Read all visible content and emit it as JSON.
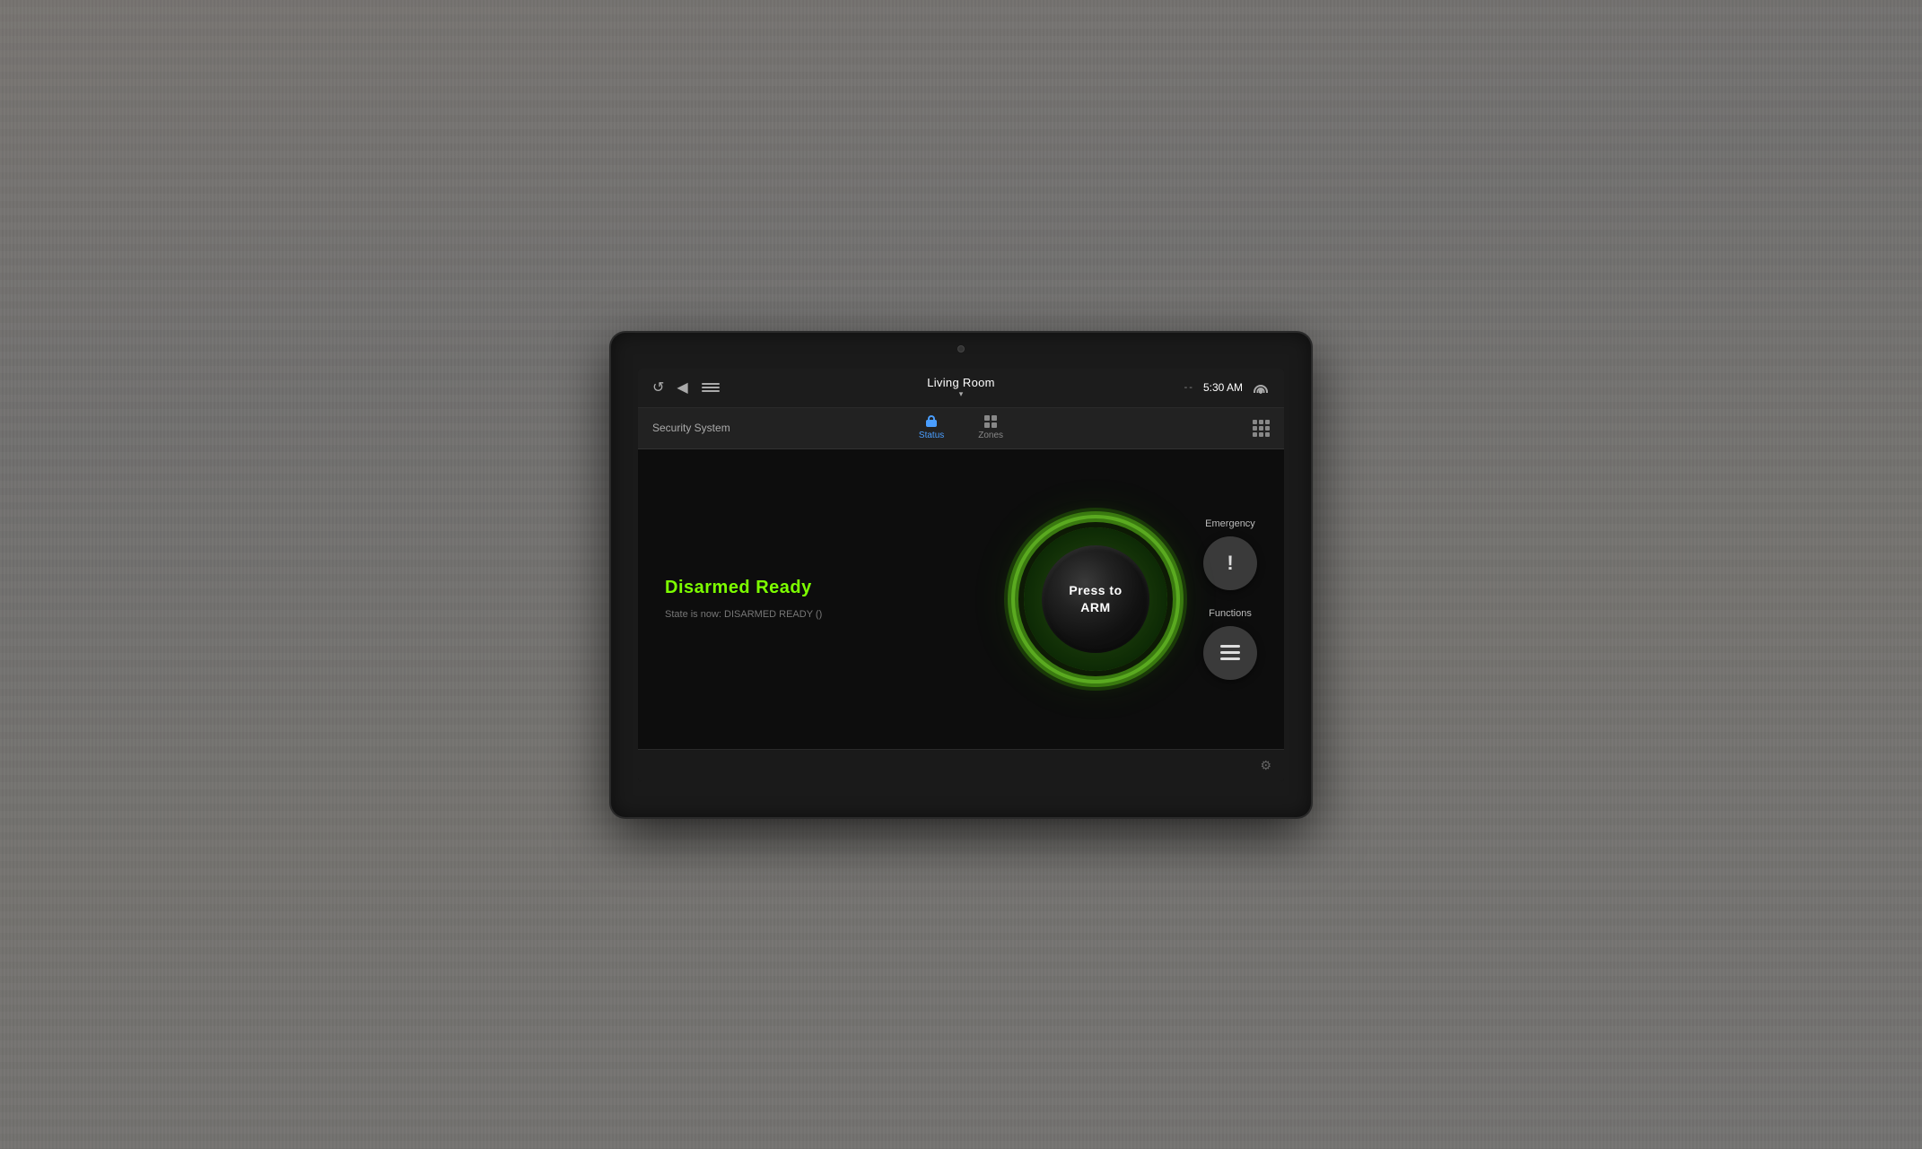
{
  "device": {
    "room_title": "Living Room",
    "room_subtitle": "▾",
    "time": "5:30 AM",
    "signal_status": "--"
  },
  "nav": {
    "section_title": "Security System",
    "tabs": [
      {
        "id": "status",
        "label": "Status",
        "active": true
      },
      {
        "id": "zones",
        "label": "Zones",
        "active": false
      }
    ]
  },
  "security": {
    "status_label": "Disarmed Ready",
    "state_text": "State is now: DISARMED READY ()",
    "arm_button_line1": "Press to",
    "arm_button_line2": "ARM",
    "arm_button_text": "Press to\nARM"
  },
  "actions": {
    "emergency": {
      "label": "Emergency",
      "icon": "exclamation"
    },
    "functions": {
      "label": "Functions",
      "icon": "menu"
    }
  },
  "colors": {
    "green_accent": "#7dff00",
    "blue_accent": "#4a9eff",
    "arm_glow": "#5aaa20"
  }
}
